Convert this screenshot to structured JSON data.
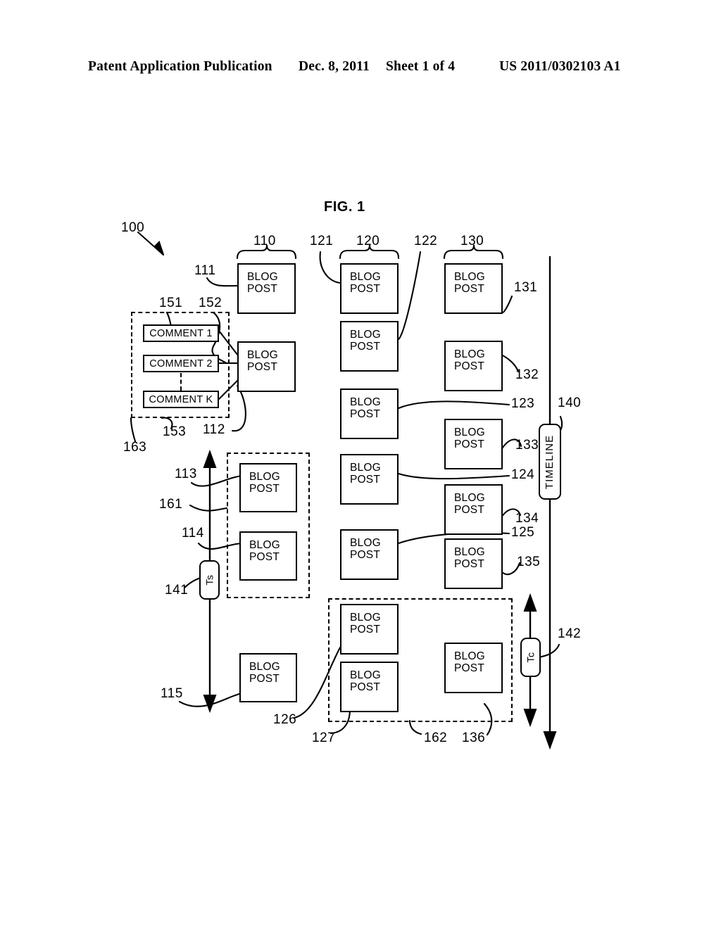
{
  "header": {
    "publication": "Patent Application Publication",
    "date": "Dec. 8, 2011",
    "sheet": "Sheet 1 of 4",
    "number": "US 2011/0302103 A1"
  },
  "figure": {
    "title": "FIG. 1",
    "system_label": "100"
  },
  "labels": {
    "blog_post": "BLOG POST",
    "blog_post_line1": "BLOG",
    "blog_post_line2": "POST",
    "timeline": "TIMELINE",
    "ts": "Ts",
    "tc": "Tc",
    "comment_1": "COMMENT 1",
    "comment_2": "COMMENT 2",
    "comment_k": "COMMENT K"
  },
  "columns": [
    {
      "brace_label": "110",
      "posts": [
        {
          "ref": "111"
        },
        {
          "ref": "112"
        },
        {
          "ref": "113"
        },
        {
          "ref": "114"
        },
        {
          "ref": "115"
        }
      ]
    },
    {
      "brace_label": "120",
      "posts": [
        {
          "ref": "121"
        },
        {
          "ref": "122"
        },
        {
          "ref": "123"
        },
        {
          "ref": "124"
        },
        {
          "ref": "125"
        },
        {
          "ref": "126"
        },
        {
          "ref": "127"
        }
      ]
    },
    {
      "brace_label": "130",
      "posts": [
        {
          "ref": "131"
        },
        {
          "ref": "132"
        },
        {
          "ref": "133"
        },
        {
          "ref": "134"
        },
        {
          "ref": "135"
        },
        {
          "ref": "136"
        }
      ]
    }
  ],
  "comment_group": {
    "ref": "163",
    "comments": [
      {
        "ref": "151",
        "label": "COMMENT 1"
      },
      {
        "ref": "152",
        "label": "COMMENT 2"
      },
      {
        "ref": "153",
        "label": "COMMENT K"
      }
    ]
  },
  "timeline": {
    "ref": "140",
    "label": "TIMELINE",
    "markers": [
      {
        "ref": "141",
        "label": "Ts"
      },
      {
        "ref": "142",
        "label": "Tc"
      }
    ]
  },
  "dashed_groups": [
    {
      "ref": "161"
    },
    {
      "ref": "162"
    },
    {
      "ref": "163"
    }
  ],
  "reference_numerals": [
    "100",
    "110",
    "111",
    "112",
    "113",
    "114",
    "115",
    "120",
    "121",
    "122",
    "123",
    "124",
    "125",
    "126",
    "127",
    "130",
    "131",
    "132",
    "133",
    "134",
    "135",
    "136",
    "140",
    "141",
    "142",
    "151",
    "152",
    "153",
    "161",
    "162",
    "163"
  ],
  "colors": {
    "ink": "#000000",
    "paper": "#ffffff"
  }
}
